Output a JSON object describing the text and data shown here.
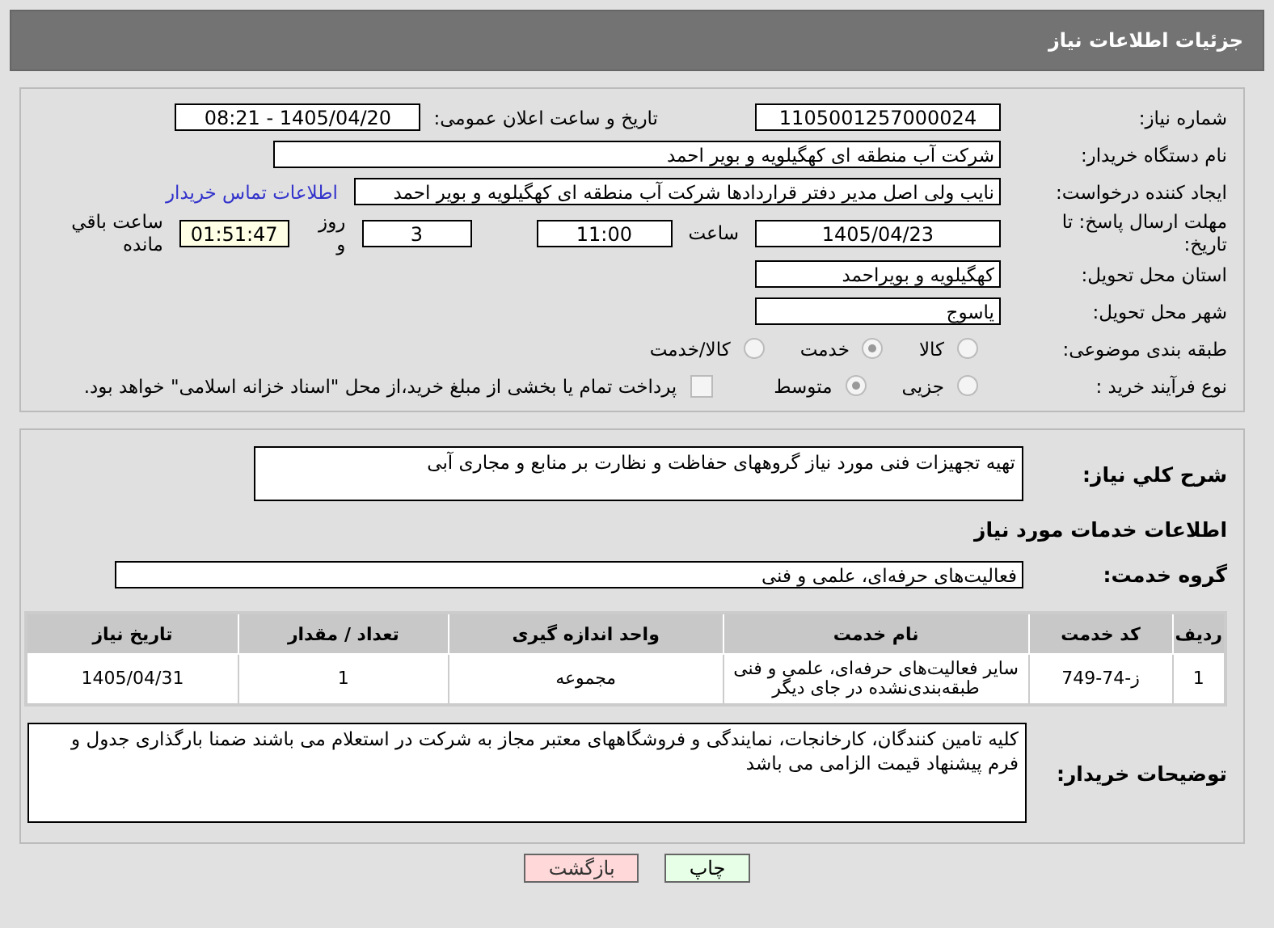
{
  "header": {
    "title": "جزئیات اطلاعات نیاز"
  },
  "need_number": {
    "label": "شماره نیاز:",
    "value": "1105001257000024"
  },
  "announce": {
    "label": "تاریخ و ساعت اعلان عمومی:",
    "value": "1405/04/20 - 08:21"
  },
  "buyer": {
    "label": "نام دستگاه خریدار:",
    "value": "شرکت آب منطقه ای کهگیلویه و بویر احمد"
  },
  "creator": {
    "label": "ایجاد کننده درخواست:",
    "value": "نایب ولی اصل مدیر دفتر قراردادها شرکت آب منطقه ای کهگیلویه و بویر احمد",
    "link": "اطلاعات تماس خریدار"
  },
  "deadline": {
    "label": "مهلت ارسال پاسخ: تا تاریخ:",
    "date": "1405/04/23",
    "time_label": "ساعت",
    "time": "11:00",
    "days": "3",
    "days_label": "روز و",
    "remaining": "01:51:47",
    "remaining_label": "ساعت باقي مانده"
  },
  "province": {
    "label": "استان محل تحویل:",
    "value": "کهگیلویه و بویراحمد"
  },
  "city": {
    "label": "شهر محل تحویل:",
    "value": "یاسوج"
  },
  "category": {
    "label": "طبقه بندی موضوعی:",
    "options": [
      {
        "label": "کالا",
        "selected": false
      },
      {
        "label": "خدمت",
        "selected": true
      },
      {
        "label": "کالا/خدمت",
        "selected": false
      }
    ]
  },
  "purchase_type": {
    "label": "نوع فرآیند خرید :",
    "options": [
      {
        "label": "جزیی",
        "selected": false
      },
      {
        "label": "متوسط",
        "selected": true
      }
    ],
    "payment": {
      "checked": false,
      "text": "پرداخت تمام یا بخشی از مبلغ خرید،از محل \"اسناد خزانه اسلامی\" خواهد بود."
    }
  },
  "description": {
    "label": "شرح کلي نیاز:",
    "value": "تهیه تجهیزات فنی مورد نیاز گروههای حفاظت و نظارت بر منابع و مجاری آبی"
  },
  "services_title": "اطلاعات خدمات مورد نیاز",
  "service_group": {
    "label": "گروه خدمت:",
    "value": "فعالیت‌های حرفه‌ای، علمی و فنی"
  },
  "table": {
    "columns": [
      "ردیف",
      "کد خدمت",
      "نام خدمت",
      "واحد اندازه گیری",
      "تعداد / مقدار",
      "تاریخ نیاز"
    ],
    "rows": [
      [
        "1",
        "ز-74-749",
        "سایر فعالیت‌های حرفه‌ای، علمی و فنی طبقه‌بندی‌نشده در جای دیگر",
        "مجموعه",
        "1",
        "1405/04/31"
      ]
    ]
  },
  "notes": {
    "label": "توضیحات خریدار:",
    "value": "کلیه تامین کنندگان، کارخانجات، نمایندگی و فروشگاههای معتبر مجاز به شرکت در استعلام می باشند ضمنا بارگذاری جدول و فرم پیشنهاد قیمت الزامی می باشد"
  },
  "buttons": [
    {
      "kind": "print",
      "label": "چاپ"
    },
    {
      "kind": "back",
      "label": "بازگشت"
    }
  ]
}
